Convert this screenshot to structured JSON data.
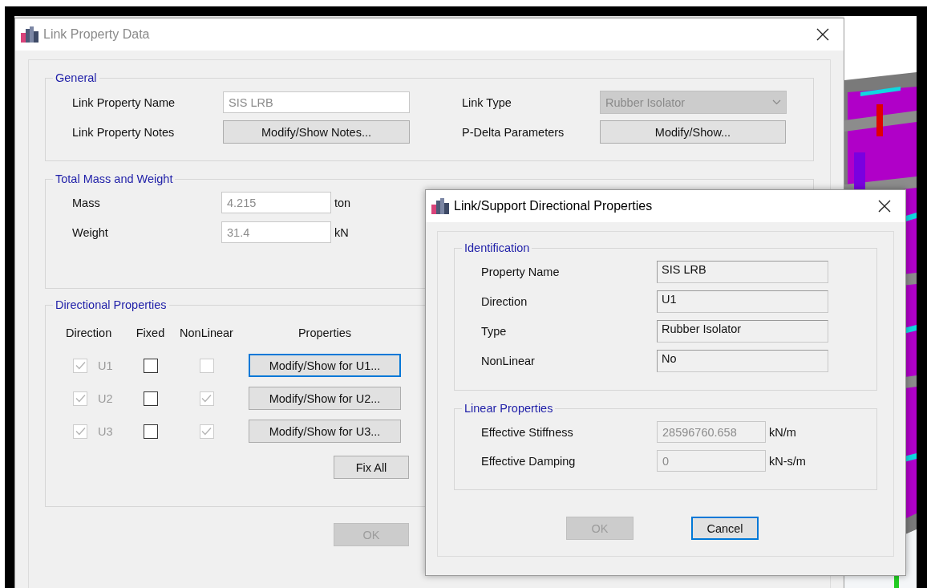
{
  "main_dialog": {
    "title": "Link Property Data",
    "active": false,
    "general": {
      "title": "General",
      "name_label": "Link Property Name",
      "name_field": {
        "value": "SIS LRB",
        "disabled": true
      },
      "type_label": "Link Type",
      "type_dropdown": {
        "value": "Rubber Isolator",
        "disabled": true
      },
      "notes_label": "Link Property Notes",
      "notes_button": {
        "label": "Modify/Show Notes...",
        "focused": false
      },
      "pdelta_label": "P-Delta Parameters",
      "pdelta_button": {
        "label": "Modify/Show...",
        "focused": false
      }
    },
    "mass_weight": {
      "title": "Total Mass and Weight",
      "rows": [
        {
          "label": "Mass",
          "value": "4.215",
          "unit": "ton",
          "disabled": true
        },
        {
          "label": "Weight",
          "value": "31.4",
          "unit": "kN",
          "disabled": true
        }
      ]
    },
    "directional": {
      "title": "Directional Properties",
      "columns": [
        "Direction",
        "Fixed",
        "NonLinear",
        "Properties"
      ],
      "rows": [
        {
          "direction": "U1",
          "direction_checked": true,
          "direction_disabled": true,
          "fixed": false,
          "fixed_disabled": false,
          "nonlinear": false,
          "nonlinear_disabled": true,
          "button": "Modify/Show for U1...",
          "focused": true
        },
        {
          "direction": "U2",
          "direction_checked": true,
          "direction_disabled": true,
          "fixed": false,
          "fixed_disabled": false,
          "nonlinear": true,
          "nonlinear_disabled": true,
          "button": "Modify/Show for U2...",
          "focused": false
        },
        {
          "direction": "U3",
          "direction_checked": true,
          "direction_disabled": true,
          "fixed": false,
          "fixed_disabled": false,
          "nonlinear": true,
          "nonlinear_disabled": true,
          "button": "Modify/Show for U3...",
          "focused": false
        }
      ],
      "fix_all": {
        "label": "Fix All",
        "disabled": false
      }
    },
    "ok_button": {
      "label": "OK",
      "disabled": true,
      "focused": false
    }
  },
  "sub_dialog": {
    "title": "Link/Support Directional Properties",
    "active": true,
    "identification": {
      "title": "Identification",
      "rows": [
        {
          "label": "Property Name",
          "value": "SIS LRB"
        },
        {
          "label": "Direction",
          "value": "U1"
        },
        {
          "label": "Type",
          "value": "Rubber Isolator"
        },
        {
          "label": "NonLinear",
          "value": "No"
        }
      ]
    },
    "linear": {
      "title": "Linear Properties",
      "rows": [
        {
          "label": "Effective Stiffness",
          "value": "28596760.658",
          "unit": "kN/m",
          "disabled": true
        },
        {
          "label": "Effective Damping",
          "value": "0",
          "unit": "kN-s/m",
          "disabled": true
        }
      ]
    },
    "buttons": [
      {
        "label": "OK",
        "disabled": true,
        "focused": false
      },
      {
        "label": "Cancel",
        "disabled": false,
        "focused": true
      }
    ]
  }
}
